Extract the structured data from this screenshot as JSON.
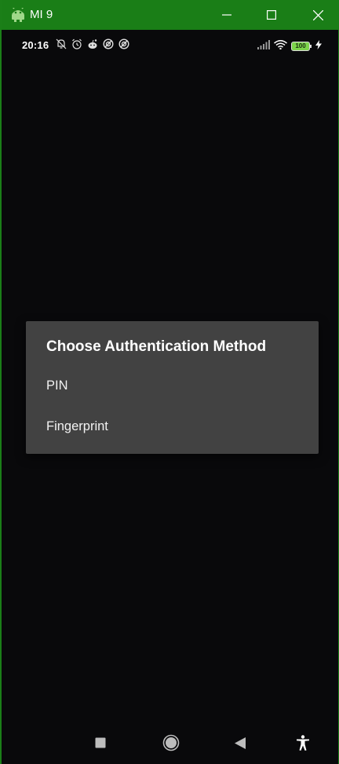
{
  "window": {
    "title": "MI 9",
    "icons": {
      "app": "android-robot-icon",
      "minimize": "minimize-icon",
      "maximize": "maximize-icon",
      "close": "close-icon"
    },
    "colors": {
      "titlebar": "#1a7e17",
      "background": "#09090b"
    }
  },
  "status_bar": {
    "time": "20:16",
    "left_icons": [
      "bell-muted-icon",
      "alarm-icon",
      "reddit-icon",
      "notification-icon",
      "notification-icon"
    ],
    "right_icons": [
      "signal-icon",
      "wifi-icon",
      "battery-icon",
      "charging-icon"
    ],
    "battery_level": "100"
  },
  "dialog": {
    "title": "Choose Authentication Method",
    "options": [
      {
        "label": "PIN"
      },
      {
        "label": "Fingerprint"
      }
    ],
    "colors": {
      "background": "#424242",
      "text": "#ffffff"
    }
  },
  "nav_bar": {
    "buttons": [
      "recents-icon",
      "home-icon",
      "back-icon",
      "accessibility-icon"
    ]
  }
}
